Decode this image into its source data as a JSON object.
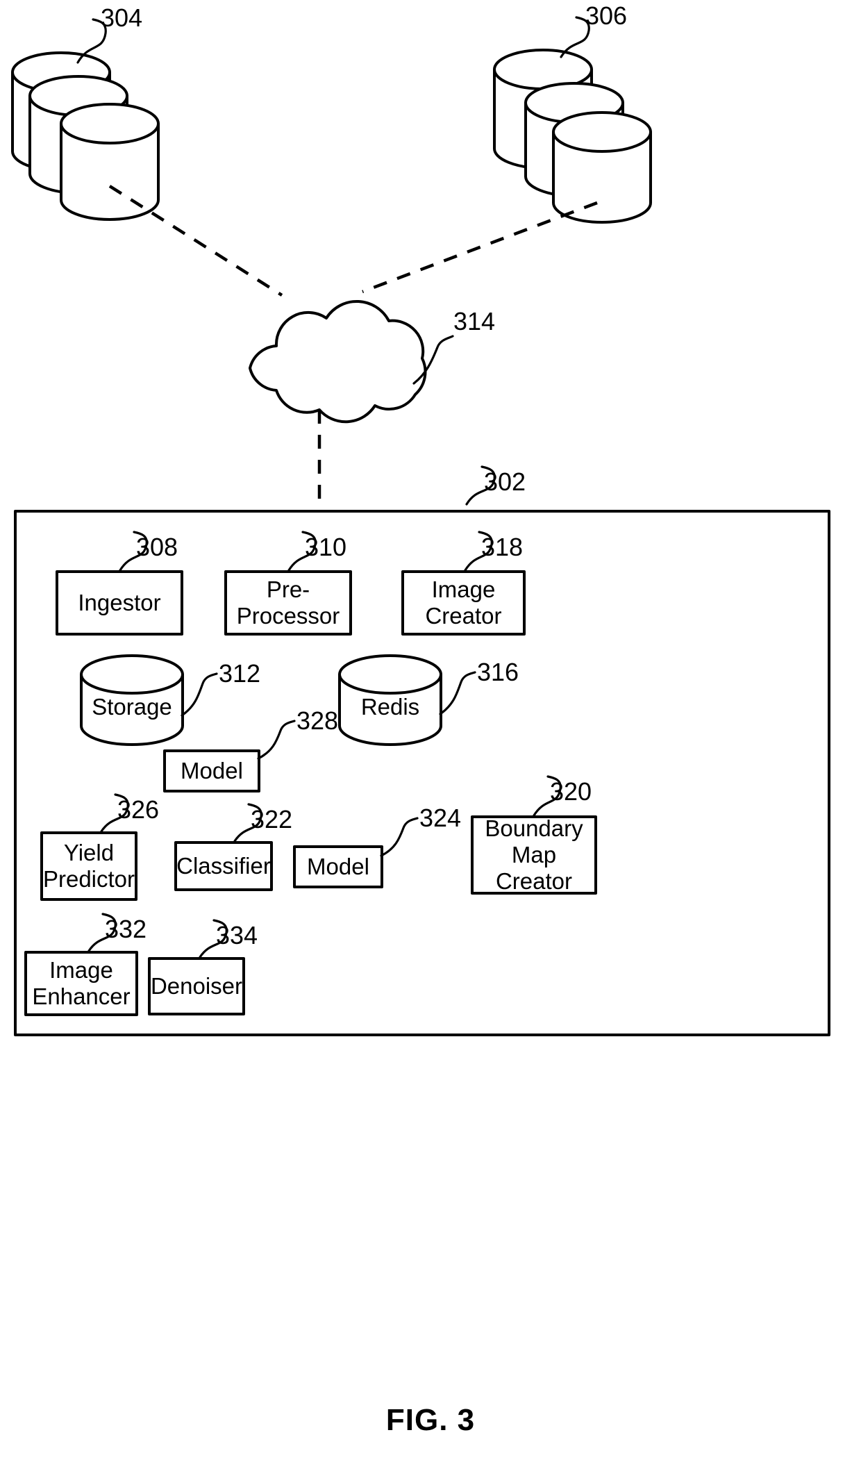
{
  "figure": {
    "caption": "FIG. 3",
    "title": "System architecture block diagram"
  },
  "external_sources": [
    {
      "name": "database-cluster-left",
      "ref": "304",
      "label": "",
      "type": "database-stack"
    },
    {
      "name": "database-cluster-right",
      "ref": "306",
      "label": "",
      "type": "database-stack"
    }
  ],
  "network": {
    "name": "cloud-network",
    "ref": "314",
    "label": "",
    "type": "cloud"
  },
  "system": {
    "ref": "302",
    "label": "",
    "components": [
      {
        "ref": "308",
        "label": "Ingestor",
        "type": "box"
      },
      {
        "ref": "310",
        "label": "Pre-\nProcessor",
        "type": "box"
      },
      {
        "ref": "318",
        "label": "Image\nCreator",
        "type": "box"
      },
      {
        "ref": "312",
        "label": "Storage",
        "type": "cylinder"
      },
      {
        "ref": "316",
        "label": "Redis",
        "type": "cylinder"
      },
      {
        "ref": "328",
        "label": "Model",
        "type": "box"
      },
      {
        "ref": "326",
        "label": "Yield\nPredictor",
        "type": "box"
      },
      {
        "ref": "322",
        "label": "Classifier",
        "type": "box"
      },
      {
        "ref": "324",
        "label": "Model",
        "type": "box"
      },
      {
        "ref": "320",
        "label": "Boundary\nMap Creator",
        "type": "box"
      },
      {
        "ref": "332",
        "label": "Image\nEnhancer",
        "type": "box"
      },
      {
        "ref": "334",
        "label": "Denoiser",
        "type": "box"
      }
    ]
  },
  "colors": {
    "ink": "#000000",
    "paper": "#ffffff"
  }
}
